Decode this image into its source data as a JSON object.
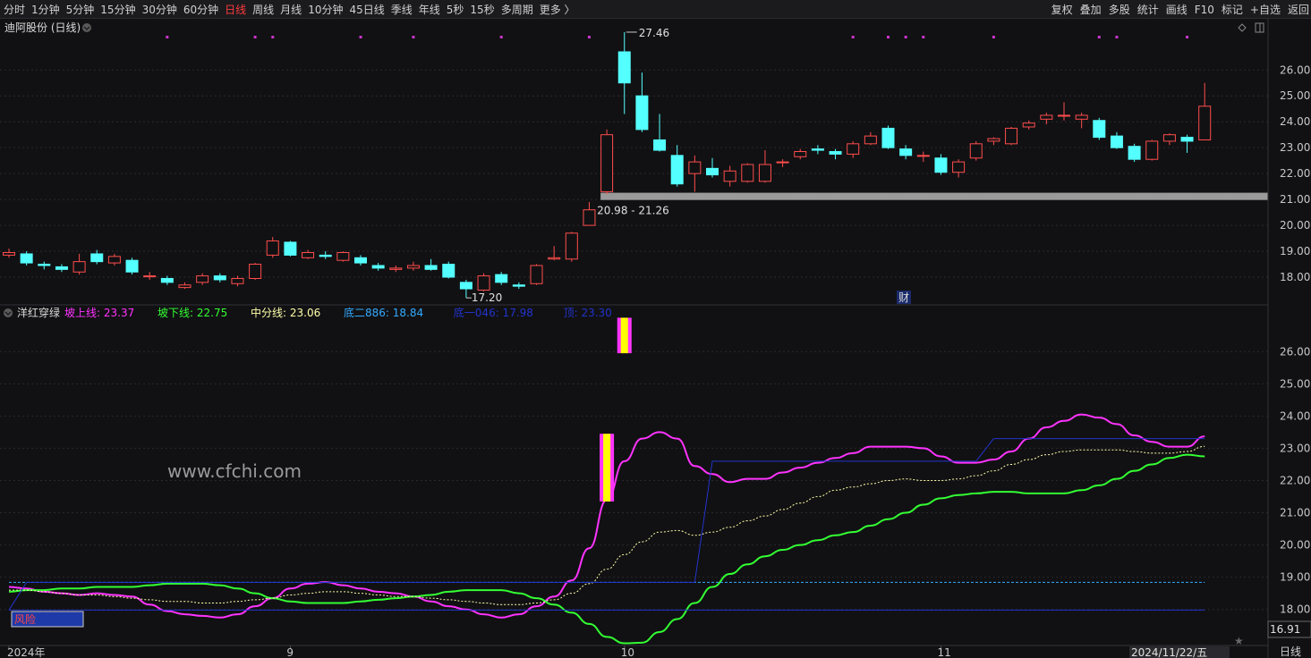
{
  "toolbar": {
    "left": [
      "分时",
      "1分钟",
      "5分钟",
      "15分钟",
      "30分钟",
      "60分钟",
      "日线",
      "周线",
      "月线",
      "10分钟",
      "45日线",
      "季线",
      "年线",
      "5秒",
      "15秒",
      "多周期",
      "更多 〉"
    ],
    "active": "日线",
    "right": [
      "复权",
      "叠加",
      "多股",
      "统计",
      "画线",
      "F10",
      "标记",
      "+自选",
      "返回"
    ]
  },
  "header": {
    "stock_title": "迪阿股份 (日线)",
    "indicator_name": "洋红穿绿",
    "legend": [
      {
        "label": "坡上线: 23.37",
        "color": "#ff33ff"
      },
      {
        "label": "坡下线: 22.75",
        "color": "#33ff33"
      },
      {
        "label": "中分线: 23.06",
        "color": "#ffffaa"
      },
      {
        "label": "底二886: 18.84",
        "color": "#33aaff"
      },
      {
        "label": "底一046: 17.98",
        "color": "#2233cc"
      },
      {
        "label": "顶: 23.30",
        "color": "#2233cc"
      }
    ]
  },
  "annotations": {
    "high_label": "27.46",
    "low_label": "17.20",
    "range_label": "20.98 - 21.26",
    "cai_badge": "财",
    "watermark": "www.cfchi.com",
    "fengxian_label": "风险",
    "last_value": "16.91",
    "period_tag": "日线",
    "date_tag": "2024/11/22/五"
  },
  "x_labels": [
    "2024年",
    "9",
    "10",
    "11"
  ],
  "chart_data": [
    {
      "type": "candlestick",
      "title": "迪阿股份 (日线)",
      "ylim": [
        17.0,
        27.7
      ],
      "yticks": [
        18,
        19,
        20,
        21,
        22,
        23,
        24,
        25,
        26
      ],
      "series": [
        {
          "name": "candles",
          "ohlc": [
            [
              18.85,
              18.95,
              19.1,
              18.75
            ],
            [
              18.9,
              18.55,
              19.0,
              18.45
            ],
            [
              18.5,
              18.45,
              18.6,
              18.3
            ],
            [
              18.4,
              18.3,
              18.5,
              18.2
            ],
            [
              18.2,
              18.6,
              18.9,
              18.1
            ],
            [
              18.9,
              18.6,
              19.05,
              18.5
            ],
            [
              18.55,
              18.8,
              18.9,
              18.45
            ],
            [
              18.65,
              18.2,
              18.75,
              18.1
            ],
            [
              18.05,
              18.05,
              18.2,
              17.9
            ],
            [
              17.95,
              17.8,
              18.05,
              17.7
            ],
            [
              17.6,
              17.7,
              17.8,
              17.55
            ],
            [
              17.8,
              18.05,
              18.15,
              17.7
            ],
            [
              18.05,
              17.9,
              18.15,
              17.8
            ],
            [
              17.75,
              17.95,
              18.05,
              17.65
            ],
            [
              17.95,
              18.5,
              18.55,
              17.9
            ],
            [
              18.85,
              19.4,
              19.55,
              18.75
            ],
            [
              19.35,
              18.85,
              19.4,
              18.8
            ],
            [
              18.75,
              18.95,
              19.05,
              18.7
            ],
            [
              18.85,
              18.8,
              19.0,
              18.7
            ],
            [
              18.65,
              18.95,
              19.0,
              18.6
            ],
            [
              18.75,
              18.55,
              18.85,
              18.45
            ],
            [
              18.45,
              18.35,
              18.55,
              18.25
            ],
            [
              18.3,
              18.35,
              18.45,
              18.2
            ],
            [
              18.35,
              18.45,
              18.6,
              18.25
            ],
            [
              18.45,
              18.3,
              18.7,
              18.25
            ],
            [
              18.5,
              18.0,
              18.6,
              17.95
            ],
            [
              17.8,
              17.55,
              17.9,
              17.2
            ],
            [
              17.5,
              18.05,
              18.15,
              17.45
            ],
            [
              18.1,
              17.8,
              18.2,
              17.7
            ],
            [
              17.7,
              17.65,
              17.8,
              17.55
            ],
            [
              17.75,
              18.45,
              18.5,
              17.7
            ],
            [
              18.7,
              18.75,
              19.2,
              18.65
            ],
            [
              18.7,
              19.7,
              19.75,
              18.6
            ],
            [
              20.0,
              20.6,
              20.9,
              20.0
            ],
            [
              21.3,
              23.5,
              23.7,
              21.2
            ],
            [
              26.7,
              25.5,
              27.46,
              24.3
            ],
            [
              25.0,
              23.7,
              25.9,
              23.6
            ],
            [
              23.3,
              22.9,
              24.3,
              22.85
            ],
            [
              22.7,
              21.6,
              23.1,
              21.5
            ],
            [
              22.0,
              22.45,
              22.7,
              21.3
            ],
            [
              22.2,
              21.95,
              22.6,
              21.85
            ],
            [
              21.7,
              22.1,
              22.3,
              21.5
            ],
            [
              21.7,
              22.35,
              22.4,
              21.65
            ],
            [
              21.7,
              22.35,
              22.9,
              21.65
            ],
            [
              22.45,
              22.45,
              22.55,
              22.25
            ],
            [
              22.65,
              22.85,
              22.95,
              22.55
            ],
            [
              22.95,
              22.9,
              23.1,
              22.75
            ],
            [
              22.85,
              22.75,
              22.95,
              22.55
            ],
            [
              22.75,
              23.15,
              23.25,
              22.6
            ],
            [
              23.15,
              23.45,
              23.6,
              23.1
            ],
            [
              23.75,
              23.0,
              23.85,
              22.95
            ],
            [
              22.95,
              22.7,
              23.1,
              22.55
            ],
            [
              22.7,
              22.7,
              22.85,
              22.45
            ],
            [
              22.6,
              22.05,
              22.75,
              21.95
            ],
            [
              22.05,
              22.45,
              22.55,
              21.85
            ],
            [
              22.6,
              23.15,
              23.25,
              22.5
            ],
            [
              23.25,
              23.35,
              23.4,
              23.1
            ],
            [
              23.15,
              23.75,
              23.8,
              23.1
            ],
            [
              23.8,
              23.95,
              24.05,
              23.7
            ],
            [
              24.1,
              24.25,
              24.35,
              23.9
            ],
            [
              24.25,
              24.25,
              24.75,
              24.05
            ],
            [
              24.1,
              24.25,
              24.35,
              23.75
            ],
            [
              24.05,
              23.4,
              24.15,
              23.3
            ],
            [
              23.45,
              23.0,
              23.6,
              22.95
            ],
            [
              23.05,
              22.55,
              23.15,
              22.45
            ],
            [
              22.55,
              23.25,
              23.3,
              22.5
            ],
            [
              23.25,
              23.5,
              23.55,
              23.1
            ],
            [
              23.4,
              23.25,
              23.5,
              22.8
            ],
            [
              23.3,
              24.6,
              25.5,
              23.4
            ]
          ]
        }
      ],
      "support_band": [
        20.98,
        21.26
      ]
    },
    {
      "type": "line",
      "title": "洋红穿绿",
      "ylim": [
        16.91,
        27.45
      ],
      "yticks": [
        18,
        19,
        20,
        21,
        22,
        23,
        24,
        25,
        26
      ],
      "series": [
        {
          "name": "坡上线",
          "color": "#ff33ff",
          "values": [
            18.7,
            18.65,
            18.55,
            18.5,
            18.45,
            18.5,
            18.45,
            18.4,
            18.15,
            17.95,
            17.85,
            17.8,
            17.75,
            17.85,
            18.1,
            18.35,
            18.65,
            18.8,
            18.85,
            18.75,
            18.65,
            18.55,
            18.5,
            18.4,
            18.25,
            18.1,
            18.0,
            17.85,
            17.75,
            17.85,
            18.1,
            18.4,
            18.9,
            19.9,
            21.4,
            22.6,
            23.3,
            23.5,
            23.3,
            22.45,
            22.2,
            21.95,
            22.05,
            22.05,
            22.25,
            22.4,
            22.55,
            22.7,
            22.85,
            23.05,
            23.05,
            23.05,
            23.0,
            22.75,
            22.55,
            22.55,
            22.65,
            22.9,
            23.3,
            23.65,
            23.85,
            24.05,
            23.95,
            23.75,
            23.4,
            23.2,
            23.05,
            23.05,
            23.37
          ]
        },
        {
          "name": "坡下线",
          "color": "#33ff33",
          "values": [
            18.55,
            18.6,
            18.6,
            18.65,
            18.65,
            18.7,
            18.7,
            18.7,
            18.75,
            18.8,
            18.8,
            18.8,
            18.75,
            18.65,
            18.5,
            18.35,
            18.25,
            18.2,
            18.2,
            18.2,
            18.25,
            18.3,
            18.35,
            18.4,
            18.45,
            18.55,
            18.6,
            18.6,
            18.6,
            18.5,
            18.35,
            18.15,
            17.9,
            17.55,
            17.15,
            16.95,
            16.97,
            17.3,
            17.7,
            18.2,
            18.7,
            19.1,
            19.4,
            19.65,
            19.85,
            20.0,
            20.15,
            20.3,
            20.4,
            20.6,
            20.8,
            21.0,
            21.25,
            21.45,
            21.55,
            21.6,
            21.65,
            21.65,
            21.6,
            21.6,
            21.6,
            21.7,
            21.85,
            22.05,
            22.3,
            22.5,
            22.7,
            22.8,
            22.75
          ]
        },
        {
          "name": "中分线",
          "color": "#ffffaa",
          "dashed": true,
          "values": [
            18.6,
            18.6,
            18.55,
            18.5,
            18.45,
            18.45,
            18.4,
            18.35,
            18.3,
            18.25,
            18.25,
            18.2,
            18.2,
            18.25,
            18.3,
            18.35,
            18.45,
            18.5,
            18.55,
            18.55,
            18.5,
            18.45,
            18.4,
            18.4,
            18.35,
            18.3,
            18.25,
            18.2,
            18.15,
            18.15,
            18.2,
            18.3,
            18.5,
            18.8,
            19.25,
            19.7,
            20.1,
            20.4,
            20.45,
            20.3,
            20.4,
            20.55,
            20.75,
            20.9,
            21.1,
            21.3,
            21.5,
            21.7,
            21.8,
            21.9,
            22.0,
            22.05,
            22.0,
            22.0,
            22.05,
            22.15,
            22.3,
            22.5,
            22.65,
            22.8,
            22.9,
            22.95,
            22.95,
            22.95,
            22.9,
            22.85,
            22.85,
            22.9,
            23.06
          ]
        },
        {
          "name": "底二886",
          "color": "#33aaff",
          "dashed": true,
          "constant": 18.84
        },
        {
          "name": "底一046",
          "color": "#2233cc",
          "constant": 17.98
        },
        {
          "name": "顶",
          "color": "#2233cc",
          "steps": [
            [
              0,
              17.98
            ],
            [
              1,
              18.84
            ],
            [
              39,
              18.84
            ],
            [
              40,
              22.6
            ],
            [
              55,
              22.6
            ],
            [
              56,
              23.3
            ],
            [
              68,
              23.3
            ]
          ]
        }
      ],
      "bar_markers": [
        {
          "index": 35,
          "low": 25.95,
          "high": 27.05
        },
        {
          "index": 34,
          "low": 21.35,
          "high": 23.45
        }
      ]
    }
  ]
}
